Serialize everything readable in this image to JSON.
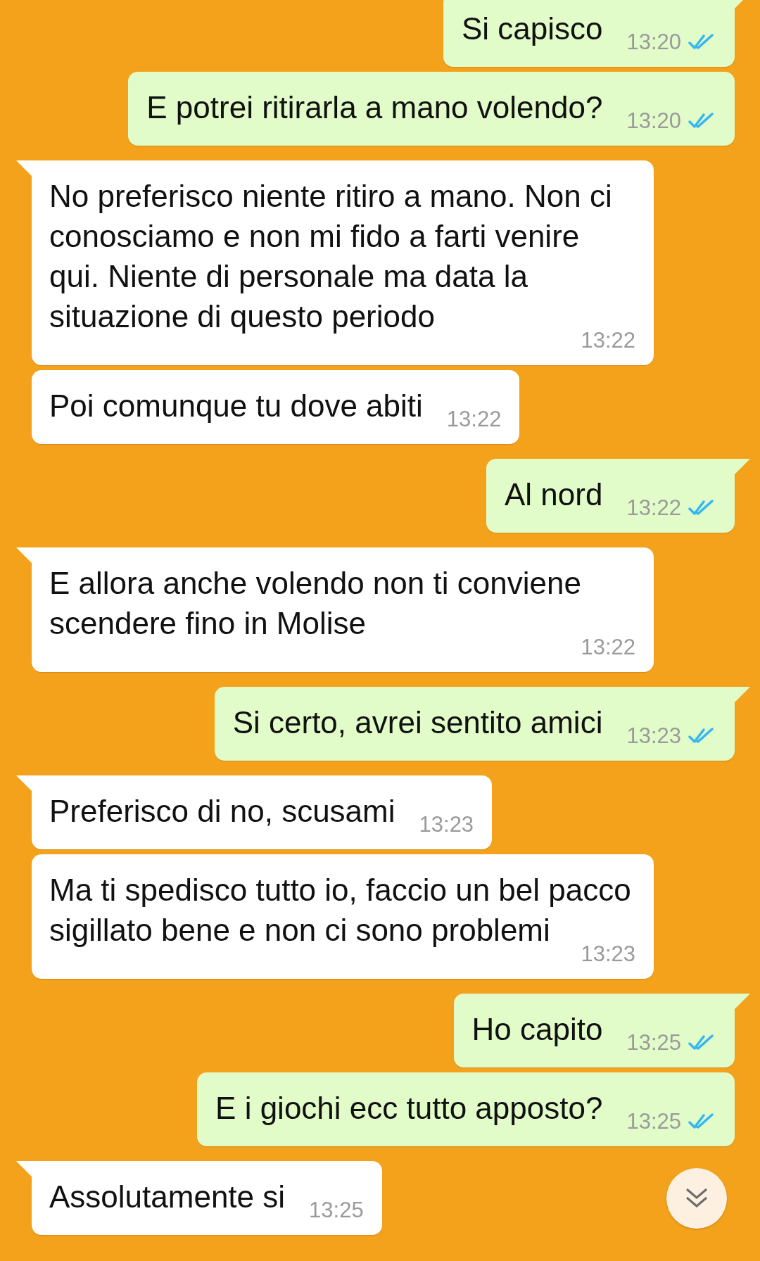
{
  "messages": [
    {
      "kind": "outgoing",
      "tail": true,
      "text": "Si capisco",
      "time": "13:20",
      "read": true
    },
    {
      "kind": "outgoing",
      "tail": false,
      "text": "E potrei ritirarla a mano volendo?",
      "time": "13:20",
      "read": true
    },
    {
      "kind": "incoming",
      "tail": true,
      "text": "No preferisco niente ritiro a mano. Non ci conosciamo e non mi fido a farti venire qui. Niente di personale ma data la situazione di questo periodo",
      "time": "13:22"
    },
    {
      "kind": "incoming",
      "tail": false,
      "text": "Poi comunque tu dove abiti",
      "time": "13:22"
    },
    {
      "kind": "outgoing",
      "tail": true,
      "text": "Al nord",
      "time": "13:22",
      "read": true
    },
    {
      "kind": "incoming",
      "tail": true,
      "text": "E allora anche volendo non ti conviene scendere fino in Molise",
      "time": "13:22"
    },
    {
      "kind": "outgoing",
      "tail": true,
      "text": "Si certo, avrei sentito amici",
      "time": "13:23",
      "read": true
    },
    {
      "kind": "incoming",
      "tail": true,
      "text": "Preferisco di no, scusami",
      "time": "13:23"
    },
    {
      "kind": "incoming",
      "tail": false,
      "text": "Ma ti spedisco tutto io, faccio un bel pacco sigillato bene e non ci sono problemi",
      "time": "13:23"
    },
    {
      "kind": "outgoing",
      "tail": true,
      "text": "Ho capito",
      "time": "13:25",
      "read": true
    },
    {
      "kind": "outgoing",
      "tail": false,
      "text": "E i giochi ecc tutto apposto?",
      "time": "13:25",
      "read": true
    },
    {
      "kind": "incoming",
      "tail": true,
      "text": "Assolutamente si",
      "time": "13:25"
    }
  ]
}
